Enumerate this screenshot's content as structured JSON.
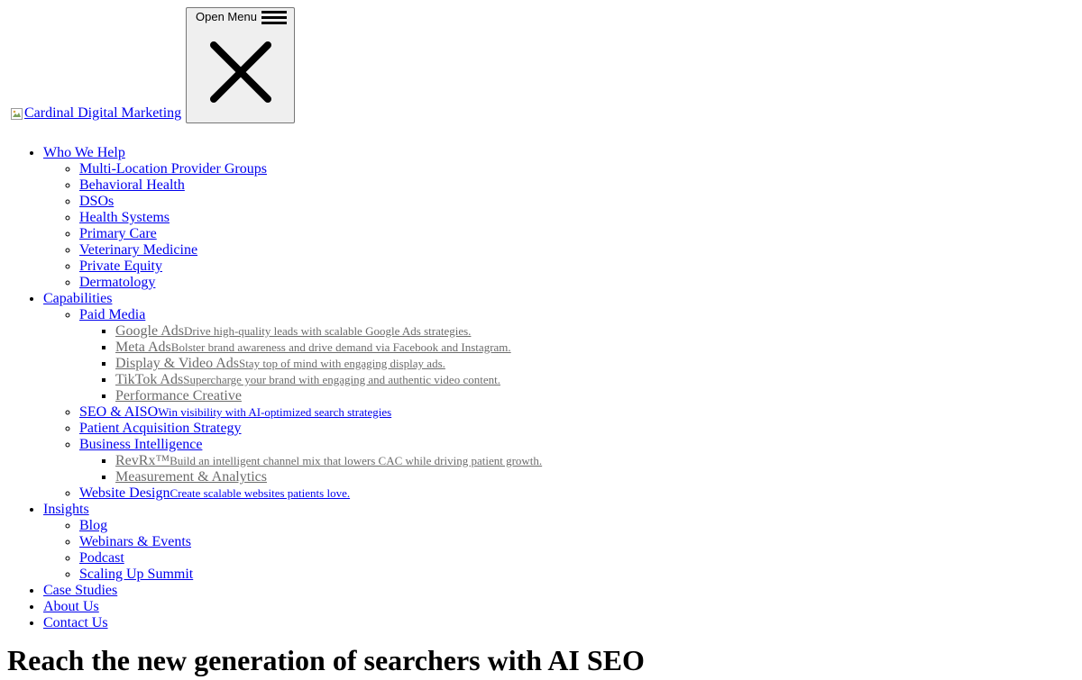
{
  "header": {
    "logo_alt": "Cardinal Digital Marketing",
    "menu_button_label": "Open Menu"
  },
  "nav": {
    "who_we_help": {
      "label": "Who We Help",
      "items": [
        "Multi-Location Provider Groups",
        "Behavioral Health",
        "DSOs",
        "Health Systems",
        "Primary Care",
        "Veterinary Medicine",
        "Private Equity",
        "Dermatology"
      ]
    },
    "capabilities": {
      "label": "Capabilities",
      "paid_media": "Paid Media",
      "google_ads": {
        "label": "Google Ads",
        "desc": "Drive high-quality leads with scalable Google Ads strategies."
      },
      "meta_ads": {
        "label": "Meta Ads",
        "desc": "Bolster brand awareness and drive demand via Facebook and Instagram."
      },
      "display_video": {
        "label": "Display & Video Ads",
        "desc": "Stay top of mind with engaging display ads."
      },
      "tiktok_ads": {
        "label": "TikTok Ads",
        "desc": "Supercharge your brand with engaging and authentic video content."
      },
      "performance_creative": "Performance Creative",
      "seo_aiso": {
        "label": "SEO & AISO",
        "desc": "Win visibility with AI-optimized search strategies"
      },
      "patient_acquisition": "Patient Acquisition Strategy",
      "business_intelligence": "Business Intelligence",
      "revrx": {
        "label": "RevRx™",
        "desc": "Build an intelligent channel mix that lowers CAC while driving patient growth."
      },
      "measurement": "Measurement & Analytics",
      "website_design": {
        "label": "Website Design",
        "desc": "Create scalable websites patients love."
      }
    },
    "insights": {
      "label": "Insights",
      "items": [
        "Blog",
        "Webinars & Events",
        "Podcast",
        "Scaling Up Summit"
      ]
    },
    "case_studies": "Case Studies",
    "about_us": "About Us",
    "contact_us": "Contact Us"
  },
  "hero": {
    "title": "Reach the new generation of searchers with AI SEO"
  }
}
